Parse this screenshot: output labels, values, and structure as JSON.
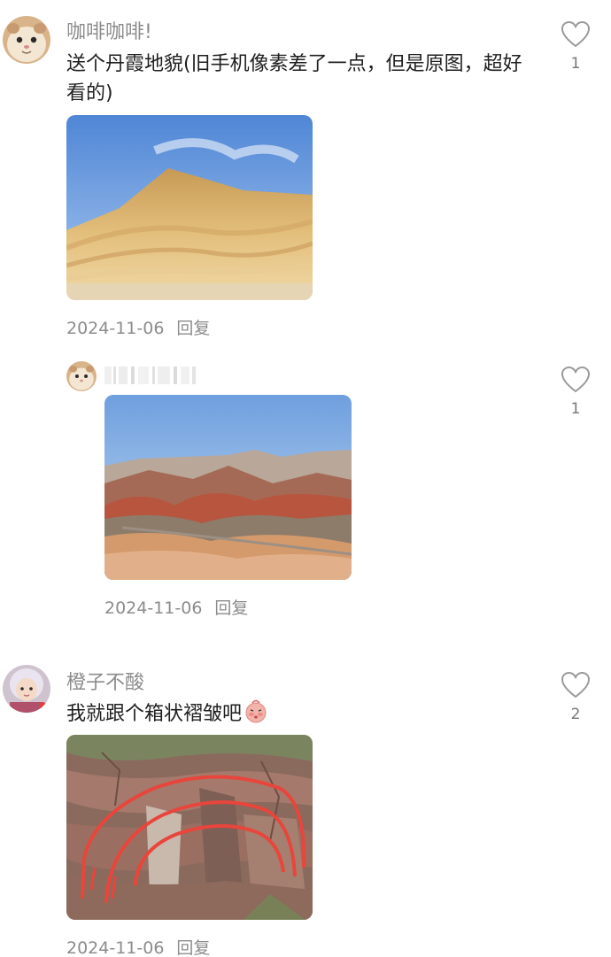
{
  "comments": [
    {
      "username": "咖啡咖啡!",
      "text": "送个丹霞地貌(旧手机像素差了一点，但是原图，超好看的)",
      "date": "2024-11-06",
      "reply_label": "回复",
      "like_count": "1",
      "avatar_icon": "hamster-avatar",
      "photo": "yellow-danxia-mountain"
    },
    {
      "username": "",
      "text": "",
      "date": "2024-11-06",
      "reply_label": "回复",
      "like_count": "1",
      "avatar_icon": "hamster-avatar",
      "photo": "rainbow-danxia-landscape"
    },
    {
      "username": "橙子不酸",
      "text": "我就跟个箱状褶皱吧",
      "date": "2024-11-06",
      "reply_label": "回复",
      "like_count": "2",
      "avatar_icon": "child-avatar",
      "photo": "box-fold-rock-annotated"
    }
  ],
  "icons": {
    "like": "heart-outline-icon",
    "emoji": "blushing-face-emoji"
  },
  "colors": {
    "meta_text": "#8c8c8c",
    "heart_stroke": "#9a9a9a",
    "annotation_red": "#e8453c"
  }
}
